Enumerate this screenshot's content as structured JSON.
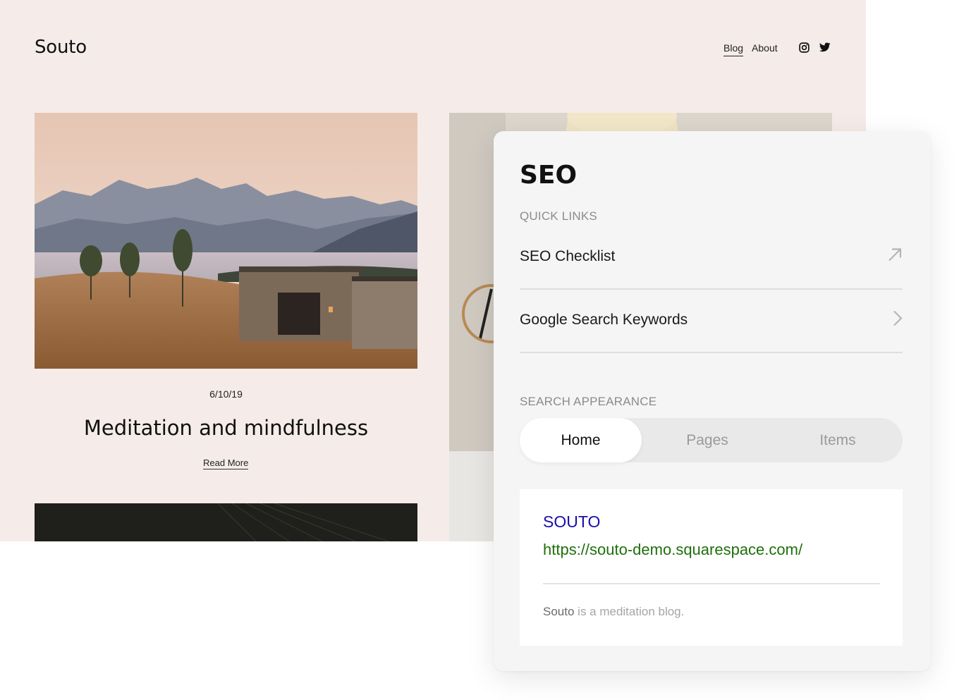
{
  "site": {
    "logo": "Souto",
    "nav": [
      {
        "label": "Blog",
        "active": true
      },
      {
        "label": "About",
        "active": false
      }
    ],
    "social_icons": [
      "instagram-icon",
      "twitter-icon"
    ],
    "post": {
      "date": "6/10/19",
      "title": "Meditation and mindfulness",
      "read_more": "Read More"
    }
  },
  "seo_panel": {
    "title": "SEO",
    "quick_links_label": "QUICK LINKS",
    "quick_links": [
      {
        "label": "SEO  Checklist",
        "icon": "external-link-arrow-icon"
      },
      {
        "label": "Google Search Keywords",
        "icon": "chevron-right-icon"
      }
    ],
    "search_appearance_label": "SEARCH APPEARANCE",
    "tabs": [
      {
        "label": "Home",
        "active": true
      },
      {
        "label": "Pages",
        "active": false
      },
      {
        "label": "Items",
        "active": false
      }
    ],
    "preview": {
      "title": "SOUTO",
      "url": "https://souto-demo.squarespace.com/",
      "description_site": "Souto",
      "description_rest": " is a meditation blog."
    }
  },
  "colors": {
    "site_background": "#f5ece9",
    "panel_background": "#f5f5f5",
    "preview_title": "#1a0dab",
    "preview_url": "#1f6f0c"
  }
}
